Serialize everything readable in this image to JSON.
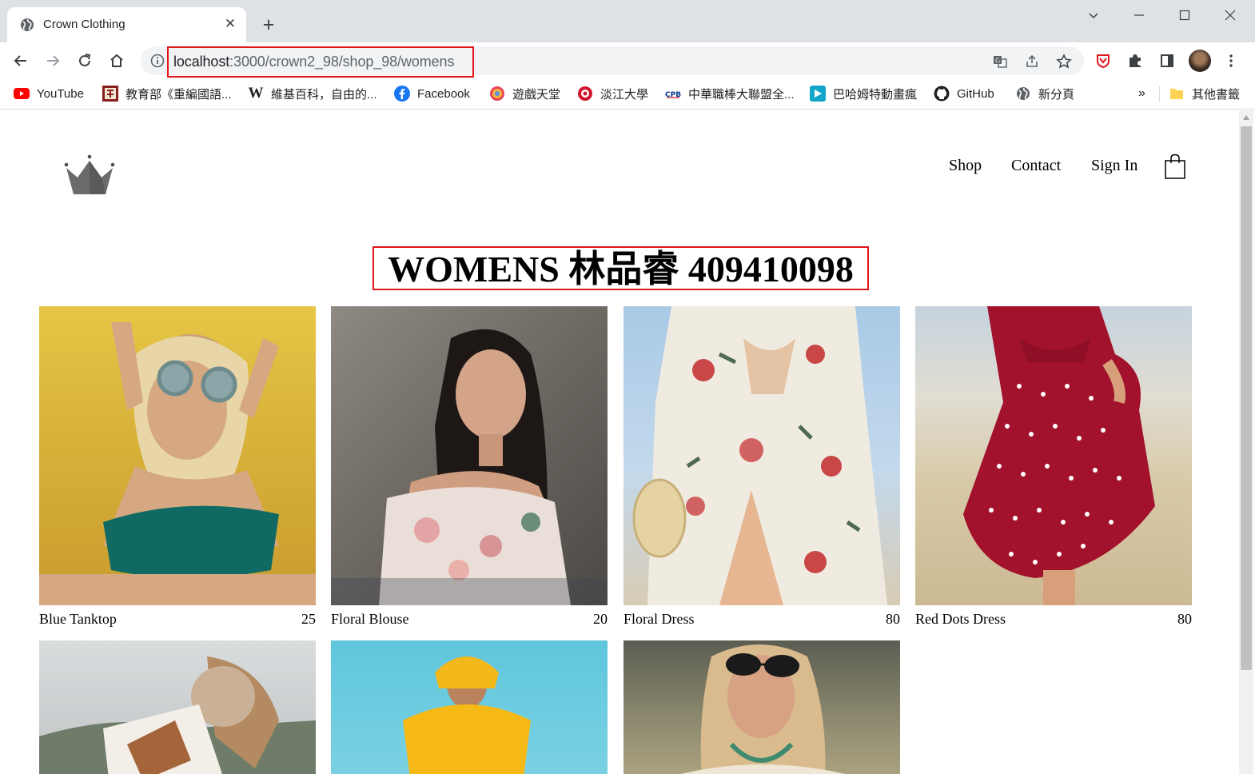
{
  "browser": {
    "tab_title": "Crown Clothing",
    "url_host": "localhost",
    "url_rest": ":3000/crown2_98/shop_98/womens",
    "bookmarks": [
      {
        "label": "YouTube",
        "icon": "youtube-icon"
      },
      {
        "label": "教育部《重編國語...",
        "icon": "moe-dictionary-icon"
      },
      {
        "label": "維基百科，自由的...",
        "icon": "wikipedia-icon"
      },
      {
        "label": "Facebook",
        "icon": "facebook-icon"
      },
      {
        "label": "遊戲天堂",
        "icon": "gamer-icon"
      },
      {
        "label": "淡江大學",
        "icon": "tku-icon"
      },
      {
        "label": "中華職棒大聯盟全...",
        "icon": "cpbl-icon"
      },
      {
        "label": "巴哈姆特動畫瘋",
        "icon": "ani-gamer-icon"
      },
      {
        "label": "GitHub",
        "icon": "github-icon"
      },
      {
        "label": "新分頁",
        "icon": "globe-icon"
      }
    ],
    "bookmarks_overflow": "»",
    "other_bookmarks": "其他書籤"
  },
  "header": {
    "nav": [
      "Shop",
      "Contact",
      "Sign In"
    ]
  },
  "page": {
    "title": "WOMENS 林品睿 409410098"
  },
  "products": [
    {
      "name": "Blue Tanktop",
      "price": "25"
    },
    {
      "name": "Floral Blouse",
      "price": "20"
    },
    {
      "name": "Floral Dress",
      "price": "80"
    },
    {
      "name": "Red Dots Dress",
      "price": "80"
    },
    {
      "name": "",
      "price": ""
    },
    {
      "name": "",
      "price": ""
    },
    {
      "name": "",
      "price": ""
    }
  ],
  "colors": {
    "highlight_border": "#e0161b",
    "chrome_bg": "#dee1e6"
  }
}
